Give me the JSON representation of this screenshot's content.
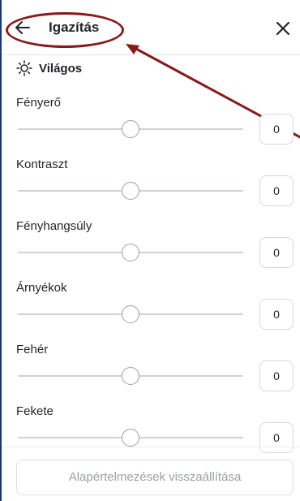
{
  "header": {
    "back_icon": "arrow-left-icon",
    "title": "Igazítás",
    "close_icon": "close-icon"
  },
  "section": {
    "icon": "sun-icon",
    "title": "Világos"
  },
  "controls": [
    {
      "label": "Fényerő",
      "value": "0",
      "level": 0.5
    },
    {
      "label": "Kontraszt",
      "value": "0",
      "level": 0.5
    },
    {
      "label": "Fényhangsúly",
      "value": "0",
      "level": 0.5
    },
    {
      "label": "Árnyékok",
      "value": "0",
      "level": 0.5
    },
    {
      "label": "Fehér",
      "value": "0",
      "level": 0.5
    },
    {
      "label": "Fekete",
      "value": "0",
      "level": 0.5
    }
  ],
  "footer": {
    "reset_label": "Alapértelmezések visszaállítása"
  },
  "annotation_color": "#8a1a1a"
}
